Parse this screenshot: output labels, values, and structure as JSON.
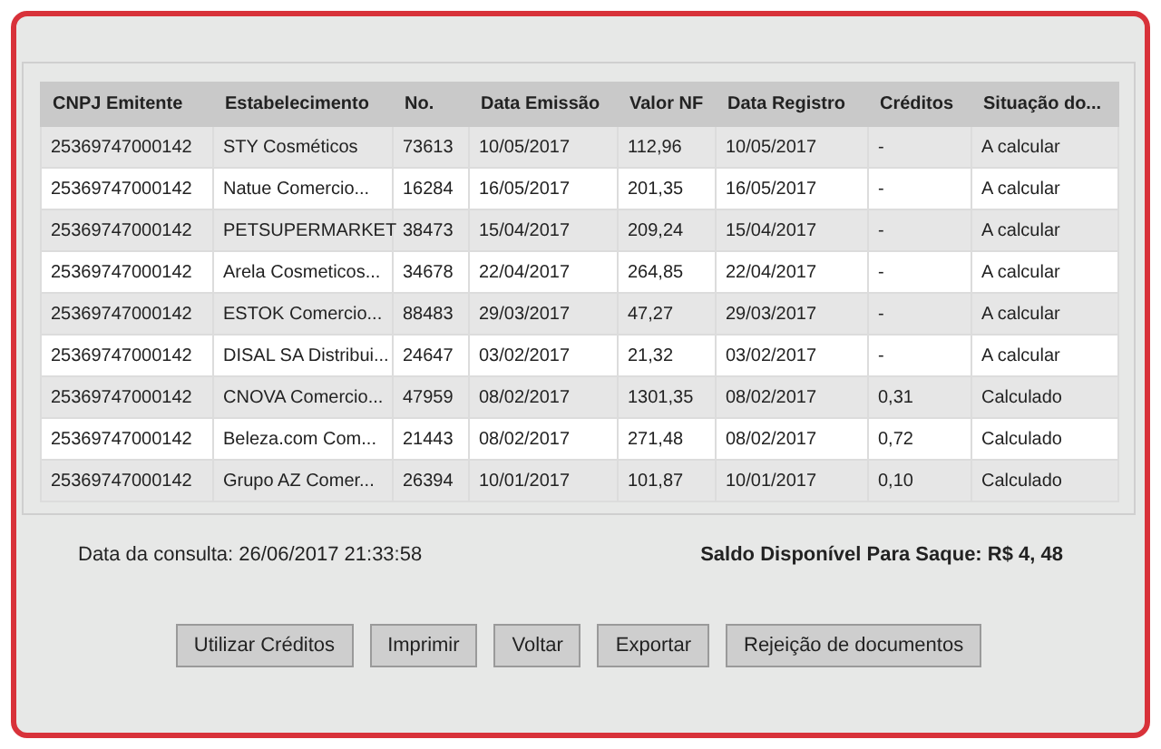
{
  "table": {
    "columns": [
      "CNPJ Emitente",
      "Estabelecimento",
      "No.",
      "Data Emissão",
      "Valor NF",
      "Data Registro",
      "Créditos",
      "Situação do..."
    ],
    "rows": [
      [
        "25369747000142",
        "STY Cosméticos",
        "73613",
        "10/05/2017",
        "112,96",
        "10/05/2017",
        "-",
        "A calcular"
      ],
      [
        "25369747000142",
        "Natue Comercio...",
        "16284",
        "16/05/2017",
        "201,35",
        "16/05/2017",
        "-",
        "A calcular"
      ],
      [
        "25369747000142",
        "PETSUPERMARKET",
        "38473",
        "15/04/2017",
        "209,24",
        "15/04/2017",
        "-",
        "A calcular"
      ],
      [
        "25369747000142",
        "Arela Cosmeticos...",
        "34678",
        "22/04/2017",
        "264,85",
        "22/04/2017",
        "-",
        "A calcular"
      ],
      [
        "25369747000142",
        "ESTOK Comercio...",
        "88483",
        "29/03/2017",
        "47,27",
        "29/03/2017",
        "-",
        "A calcular"
      ],
      [
        "25369747000142",
        "DISAL SA Distribui...",
        "24647",
        "03/02/2017",
        "21,32",
        "03/02/2017",
        "-",
        "A calcular"
      ],
      [
        "25369747000142",
        "CNOVA Comercio...",
        "47959",
        "08/02/2017",
        "1301,35",
        "08/02/2017",
        "0,31",
        "Calculado"
      ],
      [
        "25369747000142",
        "Beleza.com Com...",
        "21443",
        "08/02/2017",
        "271,48",
        "08/02/2017",
        "0,72",
        "Calculado"
      ],
      [
        "25369747000142",
        "Grupo AZ Comer...",
        "26394",
        "10/01/2017",
        "101,87",
        "10/01/2017",
        "0,10",
        "Calculado"
      ]
    ]
  },
  "query_date": "Data da consulta: 26/06/2017 21:33:58",
  "balance": "Saldo Disponível Para Saque: R$ 4, 48",
  "buttons": [
    "Utilizar Créditos",
    "Imprimir",
    "Voltar",
    "Exportar",
    "Rejeição de documentos"
  ]
}
